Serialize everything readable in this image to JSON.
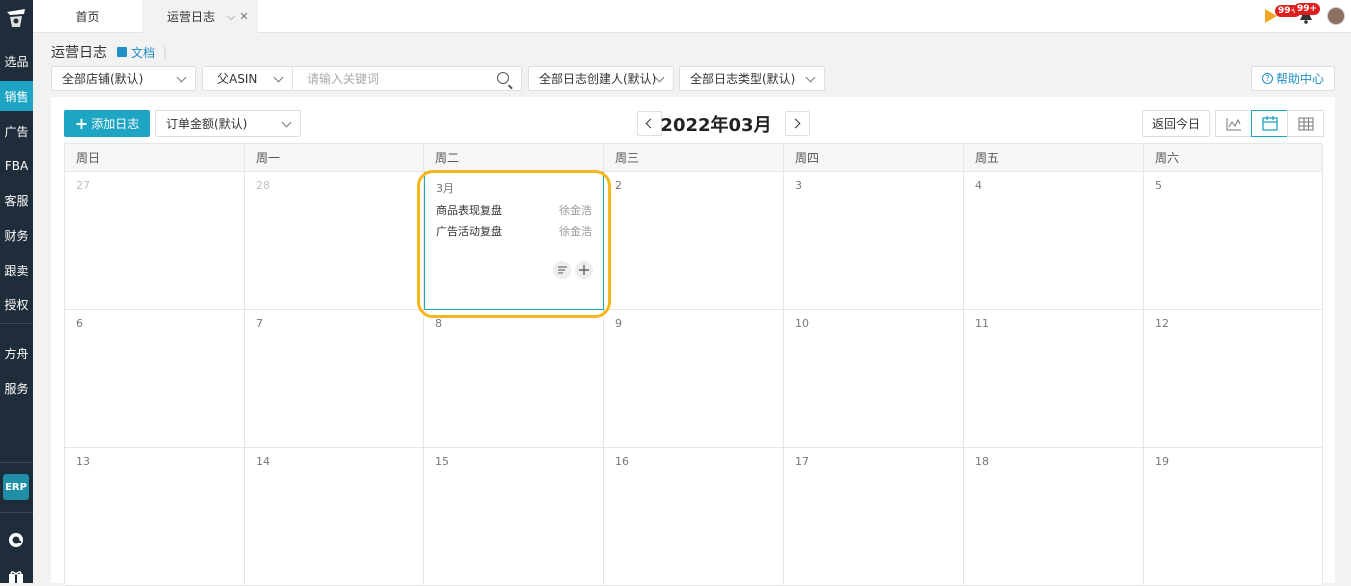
{
  "sidebar": {
    "items": [
      {
        "label": "选品",
        "active": false
      },
      {
        "label": "销售",
        "active": true
      },
      {
        "label": "广告",
        "active": false
      },
      {
        "label": "FBA",
        "active": false
      },
      {
        "label": "客服",
        "active": false
      },
      {
        "label": "财务",
        "active": false
      },
      {
        "label": "跟卖",
        "active": false
      },
      {
        "label": "授权",
        "active": false
      },
      {
        "label": "方舟",
        "active": false
      },
      {
        "label": "服务",
        "active": false
      }
    ],
    "erp_label": "ERP"
  },
  "tabs": {
    "home": "首页",
    "active": "运营日志"
  },
  "notifications": {
    "play_badge": "99+",
    "bell_badge": "99+"
  },
  "breadcrumb": {
    "title": "运营日志",
    "doc_link": "文档"
  },
  "filters": {
    "store": "全部店铺(默认)",
    "asin_type": "父ASIN",
    "search_placeholder": "请输入关键词",
    "creator": "全部日志创建人(默认)",
    "log_type": "全部日志类型(默认)",
    "help": "帮助中心"
  },
  "toolbar": {
    "add_label": "添加日志",
    "order_metric": "订单金额(默认)",
    "month_title": "2022年03月",
    "today_label": "返回今日"
  },
  "calendar": {
    "weekdays": [
      "周日",
      "周一",
      "周二",
      "周三",
      "周四",
      "周五",
      "周六"
    ],
    "weeks": [
      [
        {
          "day": "27",
          "other": true
        },
        {
          "day": "28",
          "other": true
        },
        {
          "day": "3月",
          "other": false,
          "selected": true,
          "events": [
            {
              "title": "商品表现复盘",
              "author": "徐金浩"
            },
            {
              "title": "广告活动复盘",
              "author": "徐金浩"
            }
          ]
        },
        {
          "day": "2",
          "other": false
        },
        {
          "day": "3",
          "other": false
        },
        {
          "day": "4",
          "other": false
        },
        {
          "day": "5",
          "other": false
        }
      ],
      [
        {
          "day": "6"
        },
        {
          "day": "7"
        },
        {
          "day": "8"
        },
        {
          "day": "9"
        },
        {
          "day": "10"
        },
        {
          "day": "11"
        },
        {
          "day": "12"
        }
      ],
      [
        {
          "day": "13"
        },
        {
          "day": "14"
        },
        {
          "day": "15"
        },
        {
          "day": "16"
        },
        {
          "day": "17"
        },
        {
          "day": "18"
        },
        {
          "day": "19"
        }
      ]
    ]
  },
  "colors": {
    "accent": "#1fa5c4",
    "sidebar_bg": "#1f2d3a",
    "highlight": "#f5b81c",
    "badge": "#e02020"
  }
}
